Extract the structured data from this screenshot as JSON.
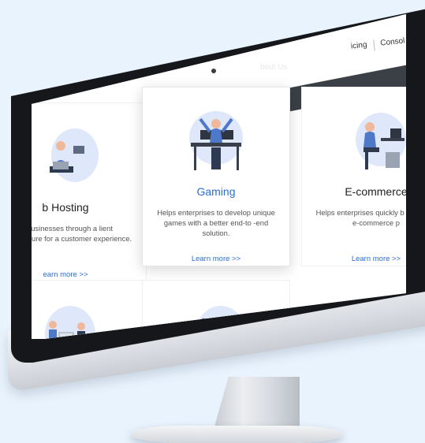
{
  "topnav": {
    "links": [
      "icing",
      "Consol"
    ]
  },
  "subnav": {
    "link": "bout Us"
  },
  "cards": [
    {
      "title": "b Hosting",
      "desc": "er businesses through a lient infrastructure for a customer experience.",
      "link": "earn more >>",
      "icon": "laptop-person-icon"
    },
    {
      "title": "Gaming",
      "desc": "Helps enterprises to develop unique games with a better end-to -end solution.",
      "link": "Learn more >>",
      "icon": "gamer-desk-icon"
    },
    {
      "title": "E-commerce",
      "desc": "Helps enterprises quickly b their own e-commerce p",
      "link": "Learn more >>",
      "icon": "ecommerce-desk-icon"
    },
    {
      "title": "",
      "desc": "",
      "link": "",
      "icon": "meeting-people-icon"
    },
    {
      "title": "",
      "desc": "",
      "link": "",
      "icon": "server-rack-person-icon"
    }
  ],
  "colors": {
    "accent": "#2a6ed6",
    "background": "#e9f3fd",
    "nav_dark": "#3b3f46"
  }
}
